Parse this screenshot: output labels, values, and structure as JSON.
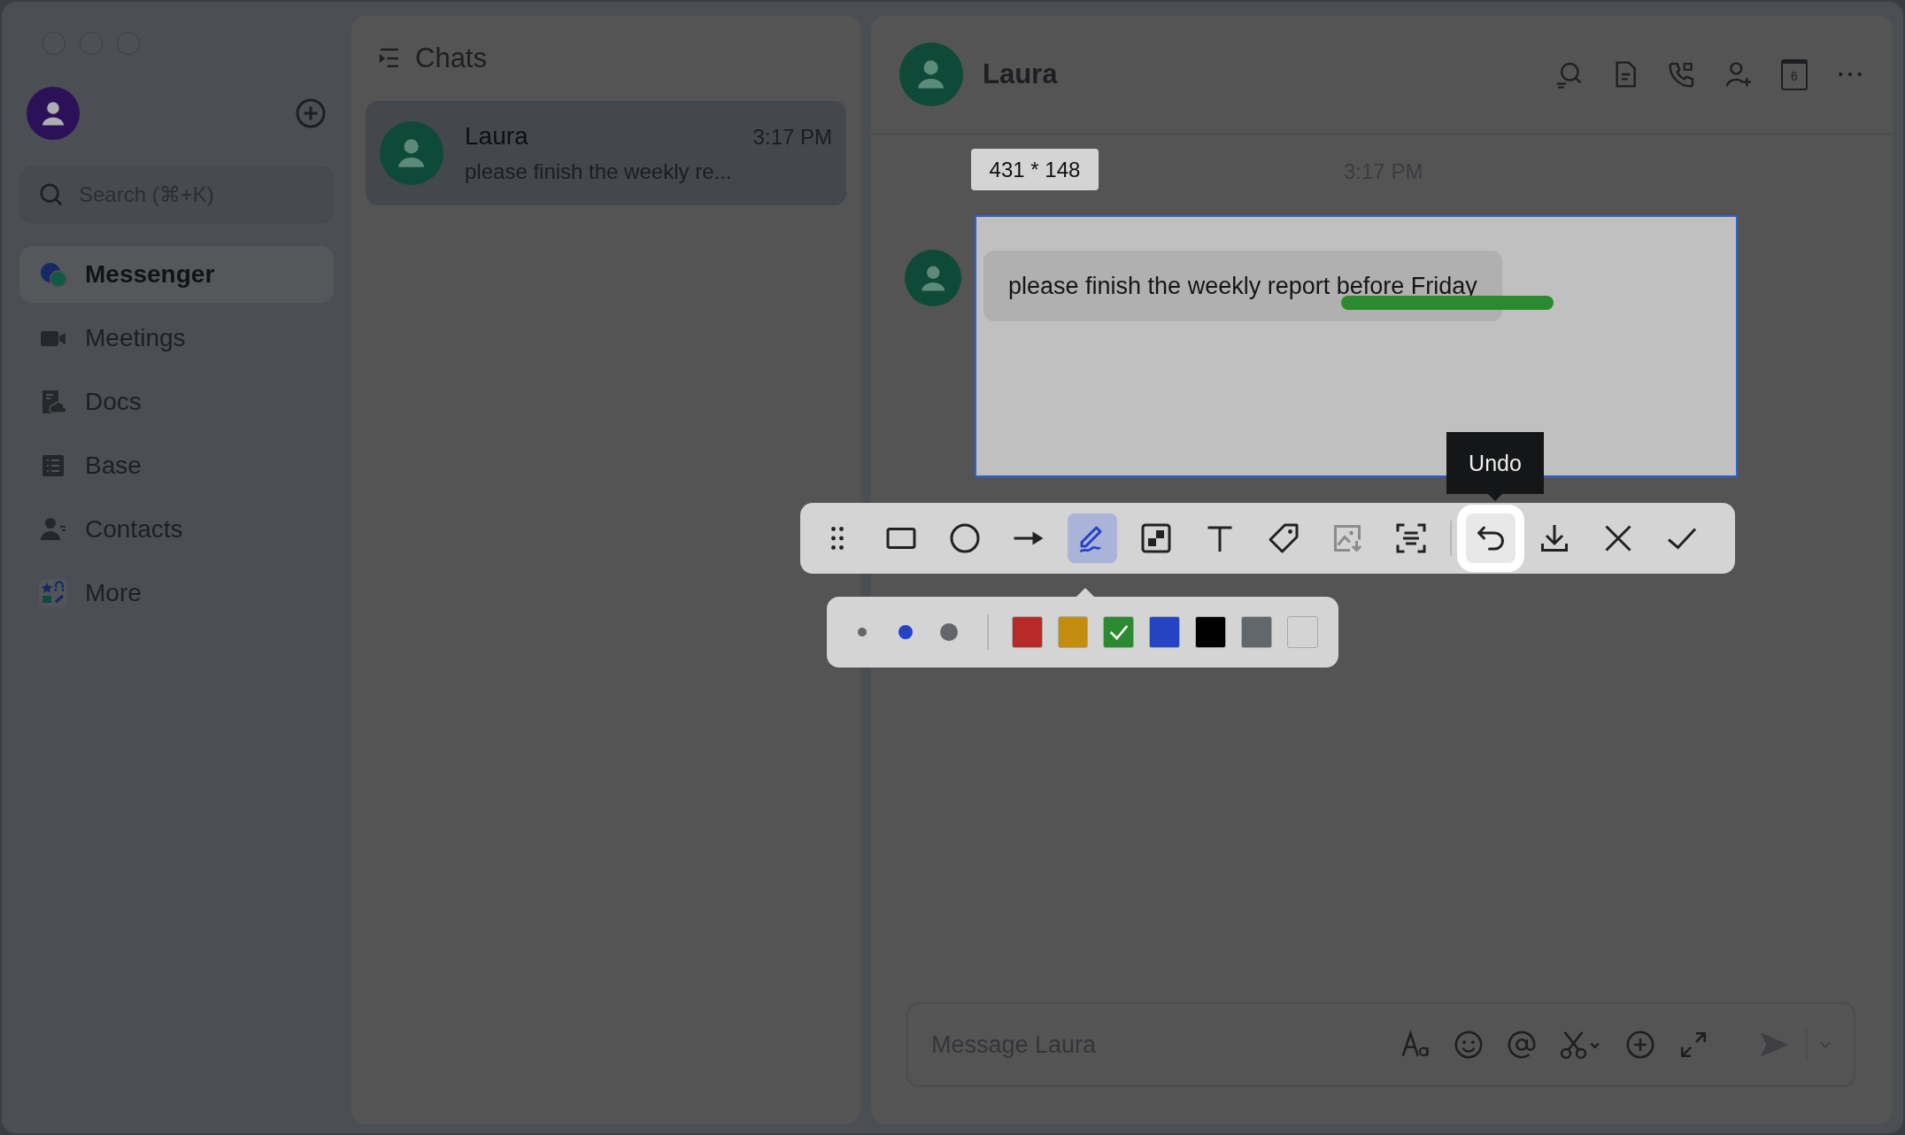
{
  "sidebar": {
    "search": {
      "placeholder": "Search (⌘+K)"
    },
    "items": [
      {
        "label": "Messenger",
        "kind": "messenger",
        "selected": true
      },
      {
        "label": "Meetings",
        "kind": "meetings",
        "selected": false
      },
      {
        "label": "Docs",
        "kind": "docs",
        "selected": false
      },
      {
        "label": "Base",
        "kind": "base",
        "selected": false
      },
      {
        "label": "Contacts",
        "kind": "contacts",
        "selected": false
      },
      {
        "label": "More",
        "kind": "more",
        "selected": false
      }
    ]
  },
  "chat_list": {
    "title": "Chats",
    "chats": [
      {
        "name": "Laura",
        "time": "3:17 PM",
        "preview": "please finish the weekly re...",
        "selected": true
      }
    ]
  },
  "conversation": {
    "title": "Laura",
    "calendar_day": "6",
    "time": "3:17 PM",
    "messages": [
      {
        "text": "please finish the weekly report before Friday"
      }
    ],
    "input": {
      "placeholder": "Message Laura"
    }
  },
  "capture": {
    "size_label": "431 * 148",
    "tooltip": "Undo",
    "tools": [
      {
        "kind": "drag",
        "selected": false,
        "disabled": false,
        "highlighted": false
      },
      {
        "kind": "rectangle",
        "selected": false,
        "disabled": false,
        "highlighted": false
      },
      {
        "kind": "ellipse",
        "selected": false,
        "disabled": false,
        "highlighted": false
      },
      {
        "kind": "arrow",
        "selected": false,
        "disabled": false,
        "highlighted": false
      },
      {
        "kind": "pen",
        "selected": true,
        "disabled": false,
        "highlighted": false
      },
      {
        "kind": "mosaic",
        "selected": false,
        "disabled": false,
        "highlighted": false
      },
      {
        "kind": "text",
        "selected": false,
        "disabled": false,
        "highlighted": false
      },
      {
        "kind": "tag",
        "selected": false,
        "disabled": false,
        "highlighted": false
      },
      {
        "kind": "image",
        "selected": false,
        "disabled": true,
        "highlighted": false
      },
      {
        "kind": "ocr",
        "selected": false,
        "disabled": false,
        "highlighted": false
      }
    ],
    "actions": [
      {
        "kind": "undo",
        "selected": false,
        "disabled": false,
        "highlighted": true
      },
      {
        "kind": "download",
        "selected": false,
        "disabled": false,
        "highlighted": false
      },
      {
        "kind": "close",
        "selected": false,
        "disabled": false,
        "highlighted": false
      },
      {
        "kind": "confirm",
        "selected": false,
        "disabled": false,
        "highlighted": false
      }
    ],
    "pen_sizes": [
      {
        "selected": false
      },
      {
        "selected": true
      },
      {
        "selected": false
      }
    ],
    "colors": [
      {
        "color": "#b82a2a",
        "selected": false
      },
      {
        "color": "#c48d10",
        "selected": false
      },
      {
        "color": "#2b8a30",
        "selected": true
      },
      {
        "color": "#2444c4",
        "selected": false
      },
      {
        "color": "#000000",
        "selected": false
      },
      {
        "color": "#62666d",
        "selected": false
      },
      {
        "color": "#d4d4d4",
        "selected": false
      }
    ]
  }
}
